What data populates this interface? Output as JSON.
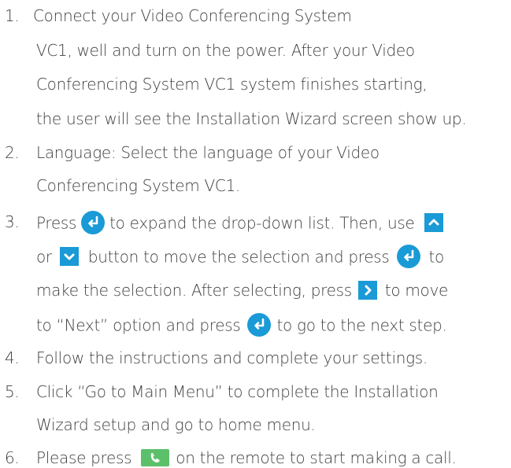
{
  "steps": [
    {
      "number": "1.",
      "lines": [
        "Connect your Video Conferencing System",
        "VC1, well and turn on the power. After your Video",
        "Conferencing System VC1 system finishes starting,",
        "the user will see the Installation Wizard screen show up."
      ]
    },
    {
      "number": "2.",
      "lines": [
        "Language: Select the language of your Video",
        "Conferencing System VC1."
      ]
    },
    {
      "number": "3.",
      "lines": {
        "l1_a": "Press",
        "l1_b": "to expand the drop-down list. Then, use",
        "l2_a": "or",
        "l2_b": "button to move the selection and press",
        "l2_c": "to",
        "l3_a": "make the selection. After selecting, press",
        "l3_b": "to move",
        "l4_a": "to “Next” option and press",
        "l4_b": "to go to the next step."
      }
    },
    {
      "number": "4.",
      "lines": [
        "Follow the instructions and complete your settings."
      ]
    },
    {
      "number": "5.",
      "lines": [
        "Click “Go to Main Menu” to complete the Installation",
        "Wizard setup and go to home menu."
      ]
    },
    {
      "number": "6.",
      "lines": {
        "a": "Please press",
        "b": "on the remote to start making a call."
      }
    }
  ],
  "icons": {
    "enter": "enter-icon",
    "up": "up-arrow-icon",
    "down": "down-arrow-icon",
    "right": "right-arrow-icon",
    "call": "phone-call-icon"
  },
  "colors": {
    "icon_blue": "#1a9ad6",
    "call_green": "#5cc06a",
    "text": "#3f3f3f"
  }
}
